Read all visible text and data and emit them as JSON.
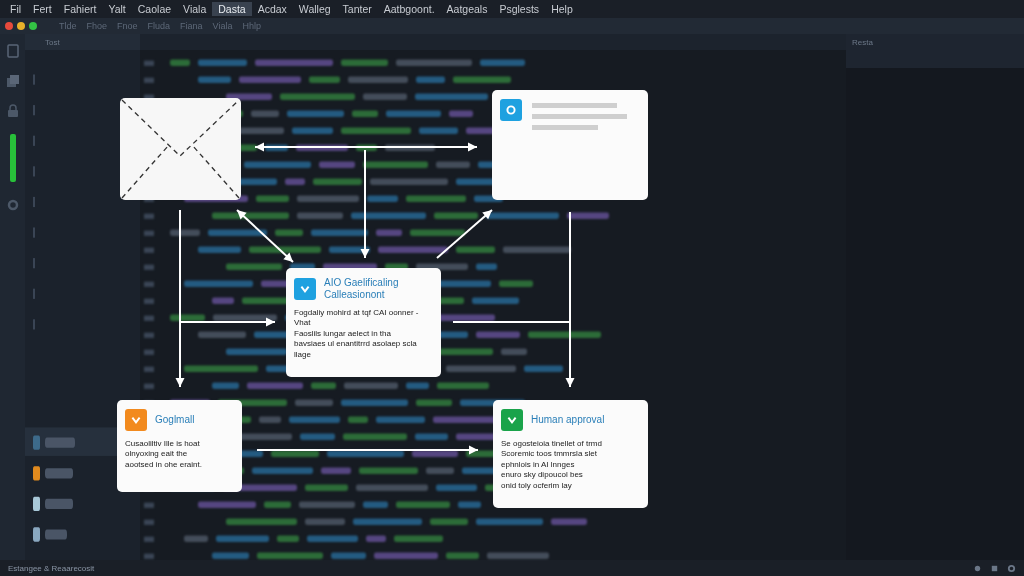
{
  "menu_bar": {
    "items": [
      {
        "label": "Fil",
        "selected": false
      },
      {
        "label": "Fert",
        "selected": false
      },
      {
        "label": "Fahiert",
        "selected": false
      },
      {
        "label": "Yalt",
        "selected": false
      },
      {
        "label": "Caolae",
        "selected": false
      },
      {
        "label": "Viala",
        "selected": false
      },
      {
        "label": "Dasta",
        "selected": true
      },
      {
        "label": "Acdax",
        "selected": false
      },
      {
        "label": "Walleg",
        "selected": false
      },
      {
        "label": "Tanter",
        "selected": false
      },
      {
        "label": "Aatbgoont.",
        "selected": false
      },
      {
        "label": "Aatgeals",
        "selected": false
      },
      {
        "label": "Psglests",
        "selected": false
      },
      {
        "label": "Help",
        "selected": false
      }
    ]
  },
  "toolbar": {
    "items": [
      "Tlde",
      "Fhoe",
      "Fnoe",
      "Fluda",
      "Fiana",
      "Viala",
      "Hhlp"
    ]
  },
  "explorer": {
    "title": "Tost"
  },
  "right_panel": {
    "title": "Resta"
  },
  "diagram": {
    "nodes": [
      {
        "kind": "envelope"
      },
      {
        "kind": "document",
        "color": "#1ea1e0"
      },
      {
        "kind": "card",
        "color": "#1ea1e0",
        "title": "AIO Gaelificaling Calleasionont",
        "bullets": [
          "Fogdaliy mohird at tqf CAI oonner - Vhat",
          "Faoslils lungar aelect in tha",
          "bavsiaes ul enantitrrd asolaep scla llage"
        ]
      },
      {
        "kind": "card",
        "color": "#f28a1e",
        "title": "Goglmall",
        "bullets": [
          "Cusaoliltiv Ille is hoat",
          "olnyoxing eait the",
          "aootsed in ohe eraint."
        ]
      },
      {
        "kind": "card",
        "color": "#1aa34a",
        "title": "Human approval",
        "bullets": [
          "Se ogosteioia tinellet of trmd",
          "Scoremic toos tmmrsla slet",
          "ephnlois in AI lnnges",
          "enuro sky dipoucol bes",
          "onid toly ocferim lay"
        ]
      }
    ],
    "connectors": [
      {
        "start_head": true,
        "end_head": true
      },
      {
        "start_head": false,
        "end_head": true
      },
      {
        "start_head": false,
        "end_head": true
      },
      {
        "start_head": false,
        "end_head": true
      },
      {
        "start_head": true,
        "end_head": true
      },
      {
        "start_head": false,
        "end_head": true
      },
      {
        "start_head": false,
        "end_head": true
      },
      {
        "start_head": false,
        "end_head": false
      },
      {
        "start_head": false,
        "end_head": true
      }
    ]
  },
  "status_bar": {
    "text": "Estangee & Reaarecosit"
  }
}
